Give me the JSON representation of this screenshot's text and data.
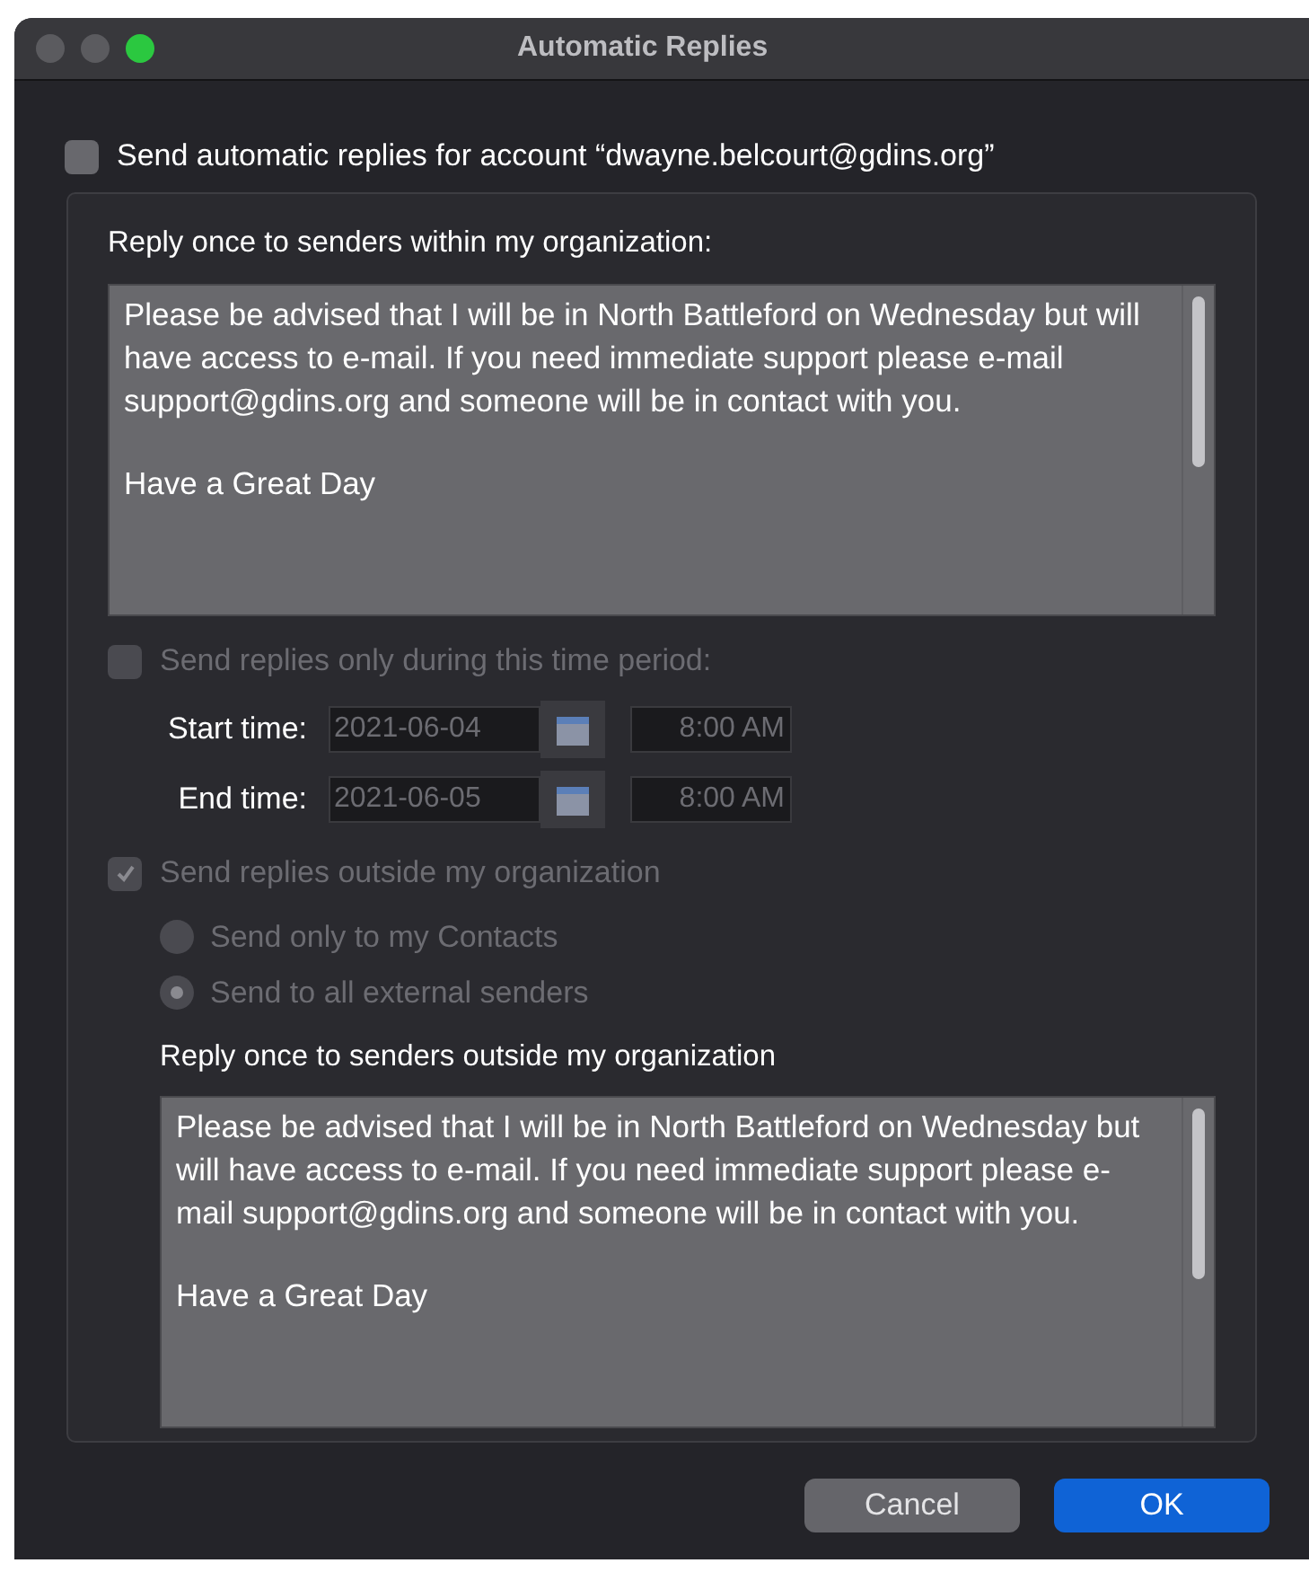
{
  "window": {
    "title": "Automatic Replies"
  },
  "enable": {
    "label": "Send automatic replies for account “dwayne.belcourt@gdins.org”",
    "checked": false
  },
  "internal": {
    "label": "Reply once to senders within my organization:",
    "message": [
      "Please be advised that I will be in North Battleford on Wednesday but will have access to e-mail. If you need immediate support please e-mail support@gdins.org and someone will be in contact with you.",
      "Have a Great Day"
    ]
  },
  "time_period": {
    "label": "Send replies only during this time period:",
    "checked": false,
    "disabled": true,
    "rows": [
      {
        "label": "Start time:",
        "date": "2021-06-04",
        "time": "8:00 AM"
      },
      {
        "label": "End time:",
        "date": "2021-06-05",
        "time": "8:00 AM"
      }
    ]
  },
  "outside": {
    "label": "Send replies outside my organization",
    "checked": true,
    "disabled": true,
    "options": [
      {
        "label": "Send only to my Contacts",
        "selected": false
      },
      {
        "label": "Send to all external senders",
        "selected": true
      }
    ],
    "message_label": "Reply once to senders outside my organization",
    "message": [
      "Please be advised that I will be in North Battleford on Wednesday but will have access to e-mail. If you need immediate support please e-mail support@gdins.org and someone will be in contact with you.",
      "Have a Great Day"
    ]
  },
  "buttons": [
    {
      "label": "Cancel",
      "kind": "secondary"
    },
    {
      "label": "OK",
      "kind": "primary"
    }
  ]
}
